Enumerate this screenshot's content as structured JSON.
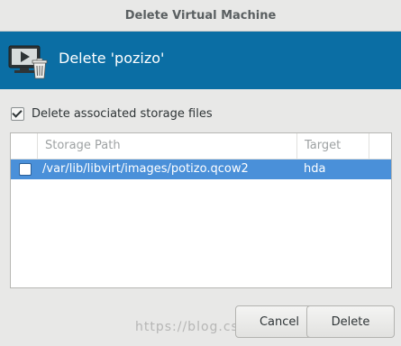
{
  "window": {
    "title": "Delete Virtual Machine"
  },
  "banner": {
    "title": "Delete 'pozizo'",
    "icon": "vm-delete-icon",
    "color": "#0b6ea4"
  },
  "options": {
    "delete_storage_label": "Delete associated storage files",
    "delete_storage_checked": true
  },
  "storage_table": {
    "columns": [
      "Storage Path",
      "Target"
    ],
    "rows": [
      {
        "checked": false,
        "path": "/var/lib/libvirt/images/potizo.qcow2",
        "target": "hda"
      }
    ],
    "selected_row_color": "#4a90d9"
  },
  "buttons": {
    "cancel_label": "Cancel",
    "delete_label": "Delete"
  },
  "watermark": {
    "text": "https://blog.csdn.net/@51CTO博客"
  }
}
